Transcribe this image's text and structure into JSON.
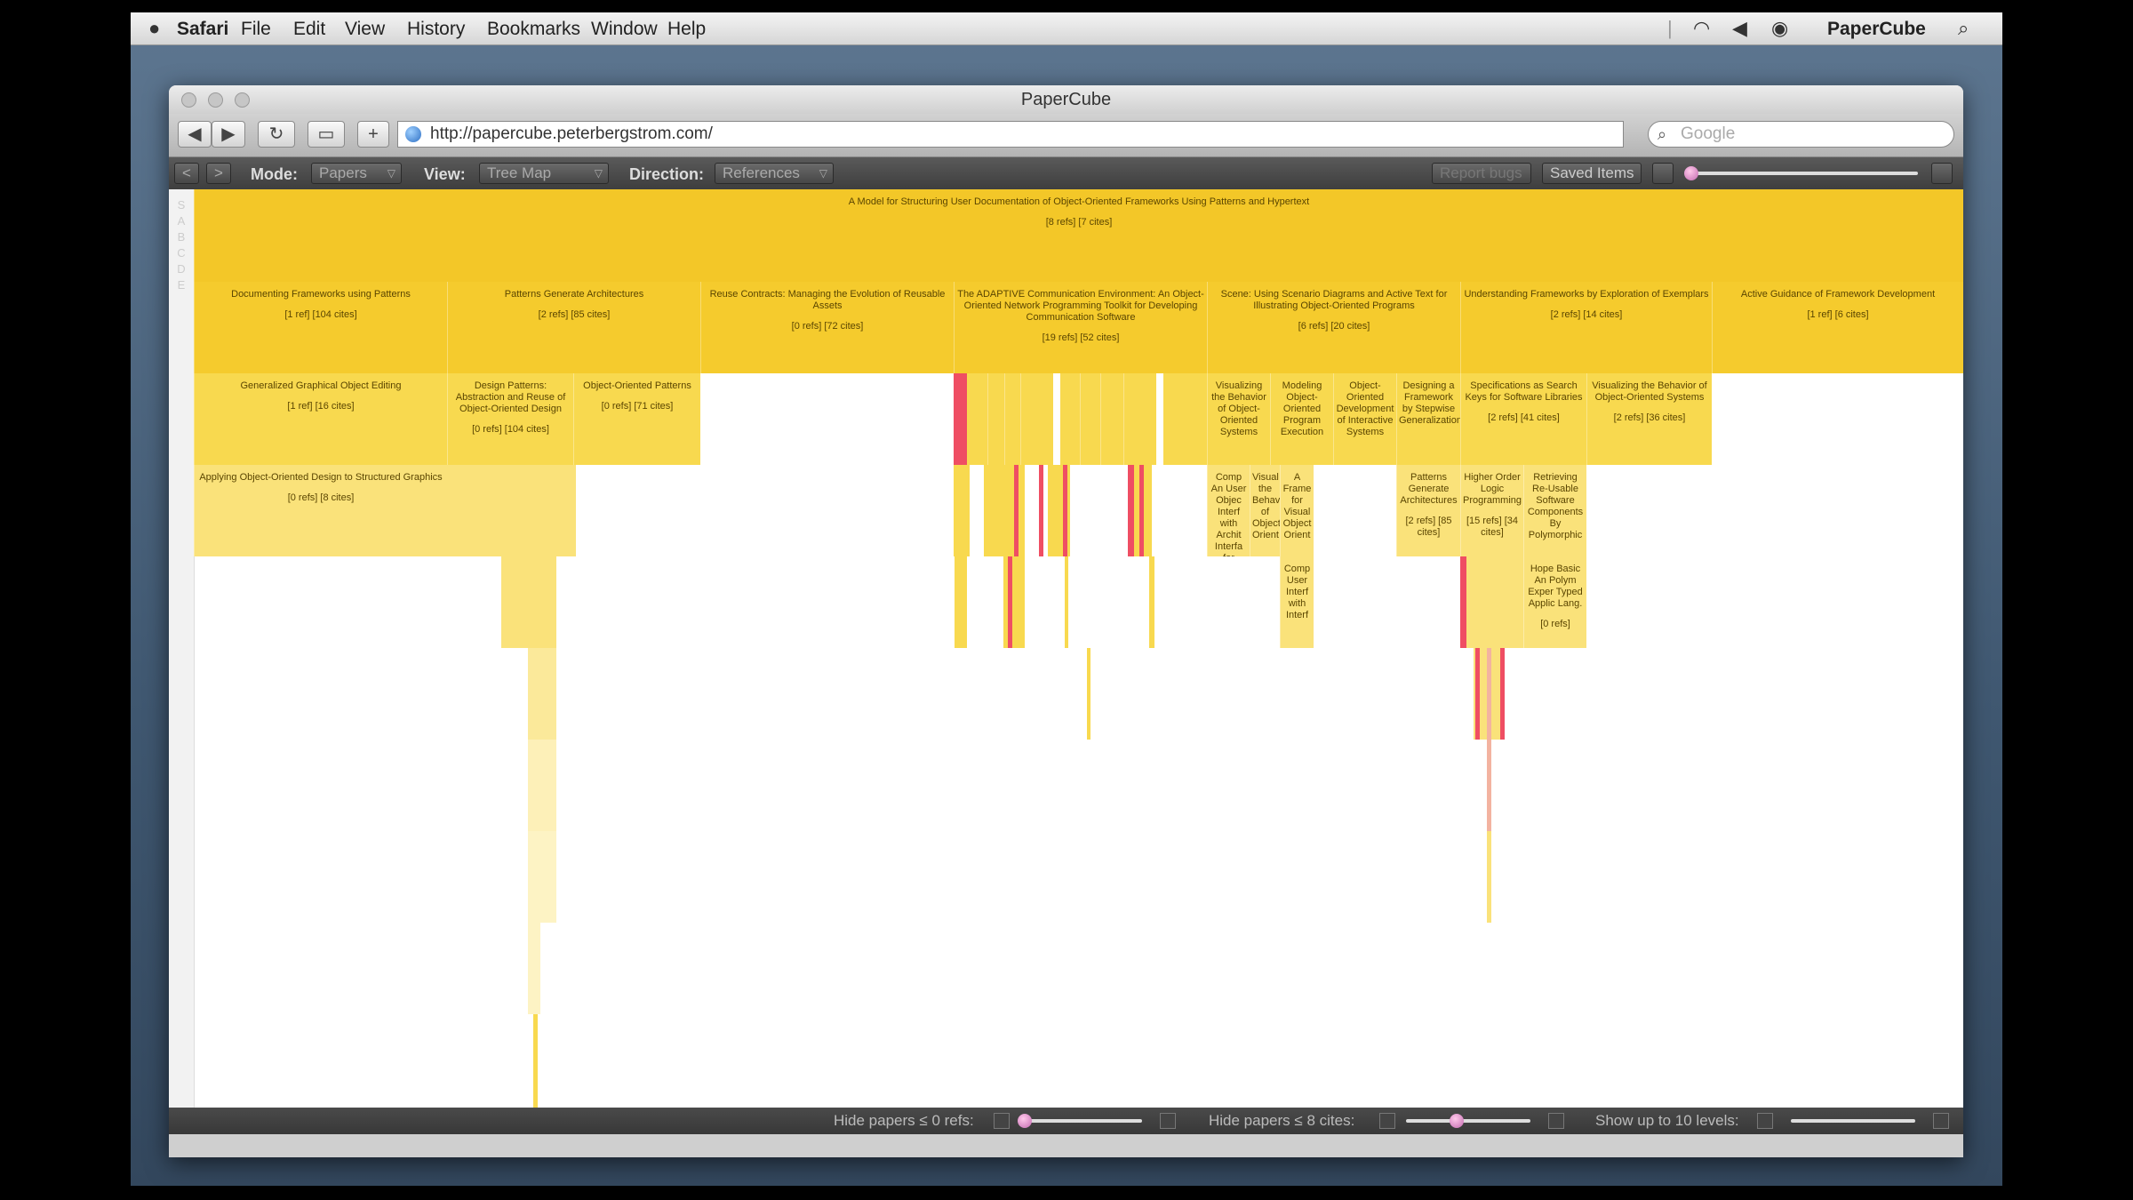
{
  "menubar": {
    "app": "Safari",
    "items": [
      "File",
      "Edit",
      "View",
      "History",
      "Bookmarks",
      "Window",
      "Help"
    ],
    "right_app": "PaperCube"
  },
  "window": {
    "title": "PaperCube",
    "url": "http://papercube.peterbergstrom.com/",
    "search_placeholder": "Google"
  },
  "appbar": {
    "mode_label": "Mode:",
    "mode_value": "Papers",
    "view_label": "View:",
    "view_value": "Tree Map",
    "direction_label": "Direction:",
    "direction_value": "References",
    "report_bugs": "Report bugs",
    "saved_items": "Saved Items",
    "zoom_level": 0.02
  },
  "treemap": {
    "root": {
      "title": "A Model for Structuring User Documentation of Object-Oriented Frameworks Using Patterns and Hypertext",
      "stats": "[8 refs] [7 cites]"
    },
    "level1": [
      {
        "title": "Documenting Frameworks using Patterns",
        "stats": "[1 ref] [104 cites]"
      },
      {
        "title": "Patterns Generate Architectures",
        "stats": "[2 refs] [85 cites]"
      },
      {
        "title": "Reuse Contracts: Managing the Evolution of Reusable Assets",
        "stats": "[0 refs] [72 cites]"
      },
      {
        "title": "The ADAPTIVE Communication Environment: An Object-Oriented Network Programming Toolkit for Developing Communication Software",
        "stats": "[19 refs] [52 cites]"
      },
      {
        "title": "Scene: Using Scenario Diagrams and Active Text for Illustrating Object-Oriented Programs",
        "stats": "[6 refs] [20 cites]"
      },
      {
        "title": "Understanding Frameworks by Exploration of Exemplars",
        "stats": "[2 refs] [14 cites]"
      },
      {
        "title": "Active Guidance of Framework Development",
        "stats": "[1 ref] [6 cites]"
      }
    ],
    "level2": [
      {
        "title": "Generalized Graphical Object Editing",
        "stats": "[1 ref] [16 cites]"
      },
      {
        "title": "Design Patterns: Abstraction and Reuse of Object-Oriented Design",
        "stats": "[0 refs] [104 cites]"
      },
      {
        "title": "Object-Oriented Patterns",
        "stats": "[0 refs] [71 cites]"
      },
      {
        "title": "Visualizing the Behavior of Object-Oriented Systems",
        "stats": ""
      },
      {
        "title": "Modeling Object-Oriented Program Execution",
        "stats": ""
      },
      {
        "title": "Object-Oriented Development of Interactive Systems",
        "stats": ""
      },
      {
        "title": "Designing a Framework by Stepwise Generalization",
        "stats": ""
      },
      {
        "title": "Specifications as Search Keys for Software Libraries",
        "stats": "[2 refs] [41 cites]"
      },
      {
        "title": "Visualizing the Behavior of Object-Oriented Systems",
        "stats": "[2 refs] [36 cites]"
      }
    ],
    "level3": [
      {
        "title": "Applying Object-Oriented Design to Structured Graphics",
        "stats": "[0 refs] [8 cites]"
      },
      {
        "title": "Comp An User Objec Interf with Archit Interfa for Const",
        "stats": ""
      },
      {
        "title": "Visual the Behav of Object Orient",
        "stats": ""
      },
      {
        "title": "A Frame for Visual Object Orient",
        "stats": ""
      },
      {
        "title": "Patterns Generate Architectures",
        "stats": "[2 refs] [85 cites]"
      },
      {
        "title": "Higher Order Logic Programming",
        "stats": "[15 refs] [34 cites]"
      },
      {
        "title": "Retrieving Re-Usable Software Components By Polymorphic",
        "stats": ""
      }
    ],
    "level4": [
      {
        "title": "Comp User Interf with Interf",
        "stats": ""
      },
      {
        "title": "Hope Basic An Polym Exper Typed Applic Lang.",
        "stats": "[0 refs]"
      }
    ]
  },
  "statusbar": {
    "hide_refs_label": "Hide papers ≤ 0 refs:",
    "hide_cites_label": "Hide papers ≤ 8 cites:",
    "levels_label": "Show up to 10 levels:",
    "hide_refs_value": 0,
    "hide_cites_value": 8,
    "levels_value": 10
  },
  "colors": {
    "root": "#f3c728",
    "level1": "#f5cb2d",
    "level2": "#f8d94f",
    "level3": "#fae27a",
    "level4": "#fbe99a",
    "highlight": "#ef4e63"
  }
}
